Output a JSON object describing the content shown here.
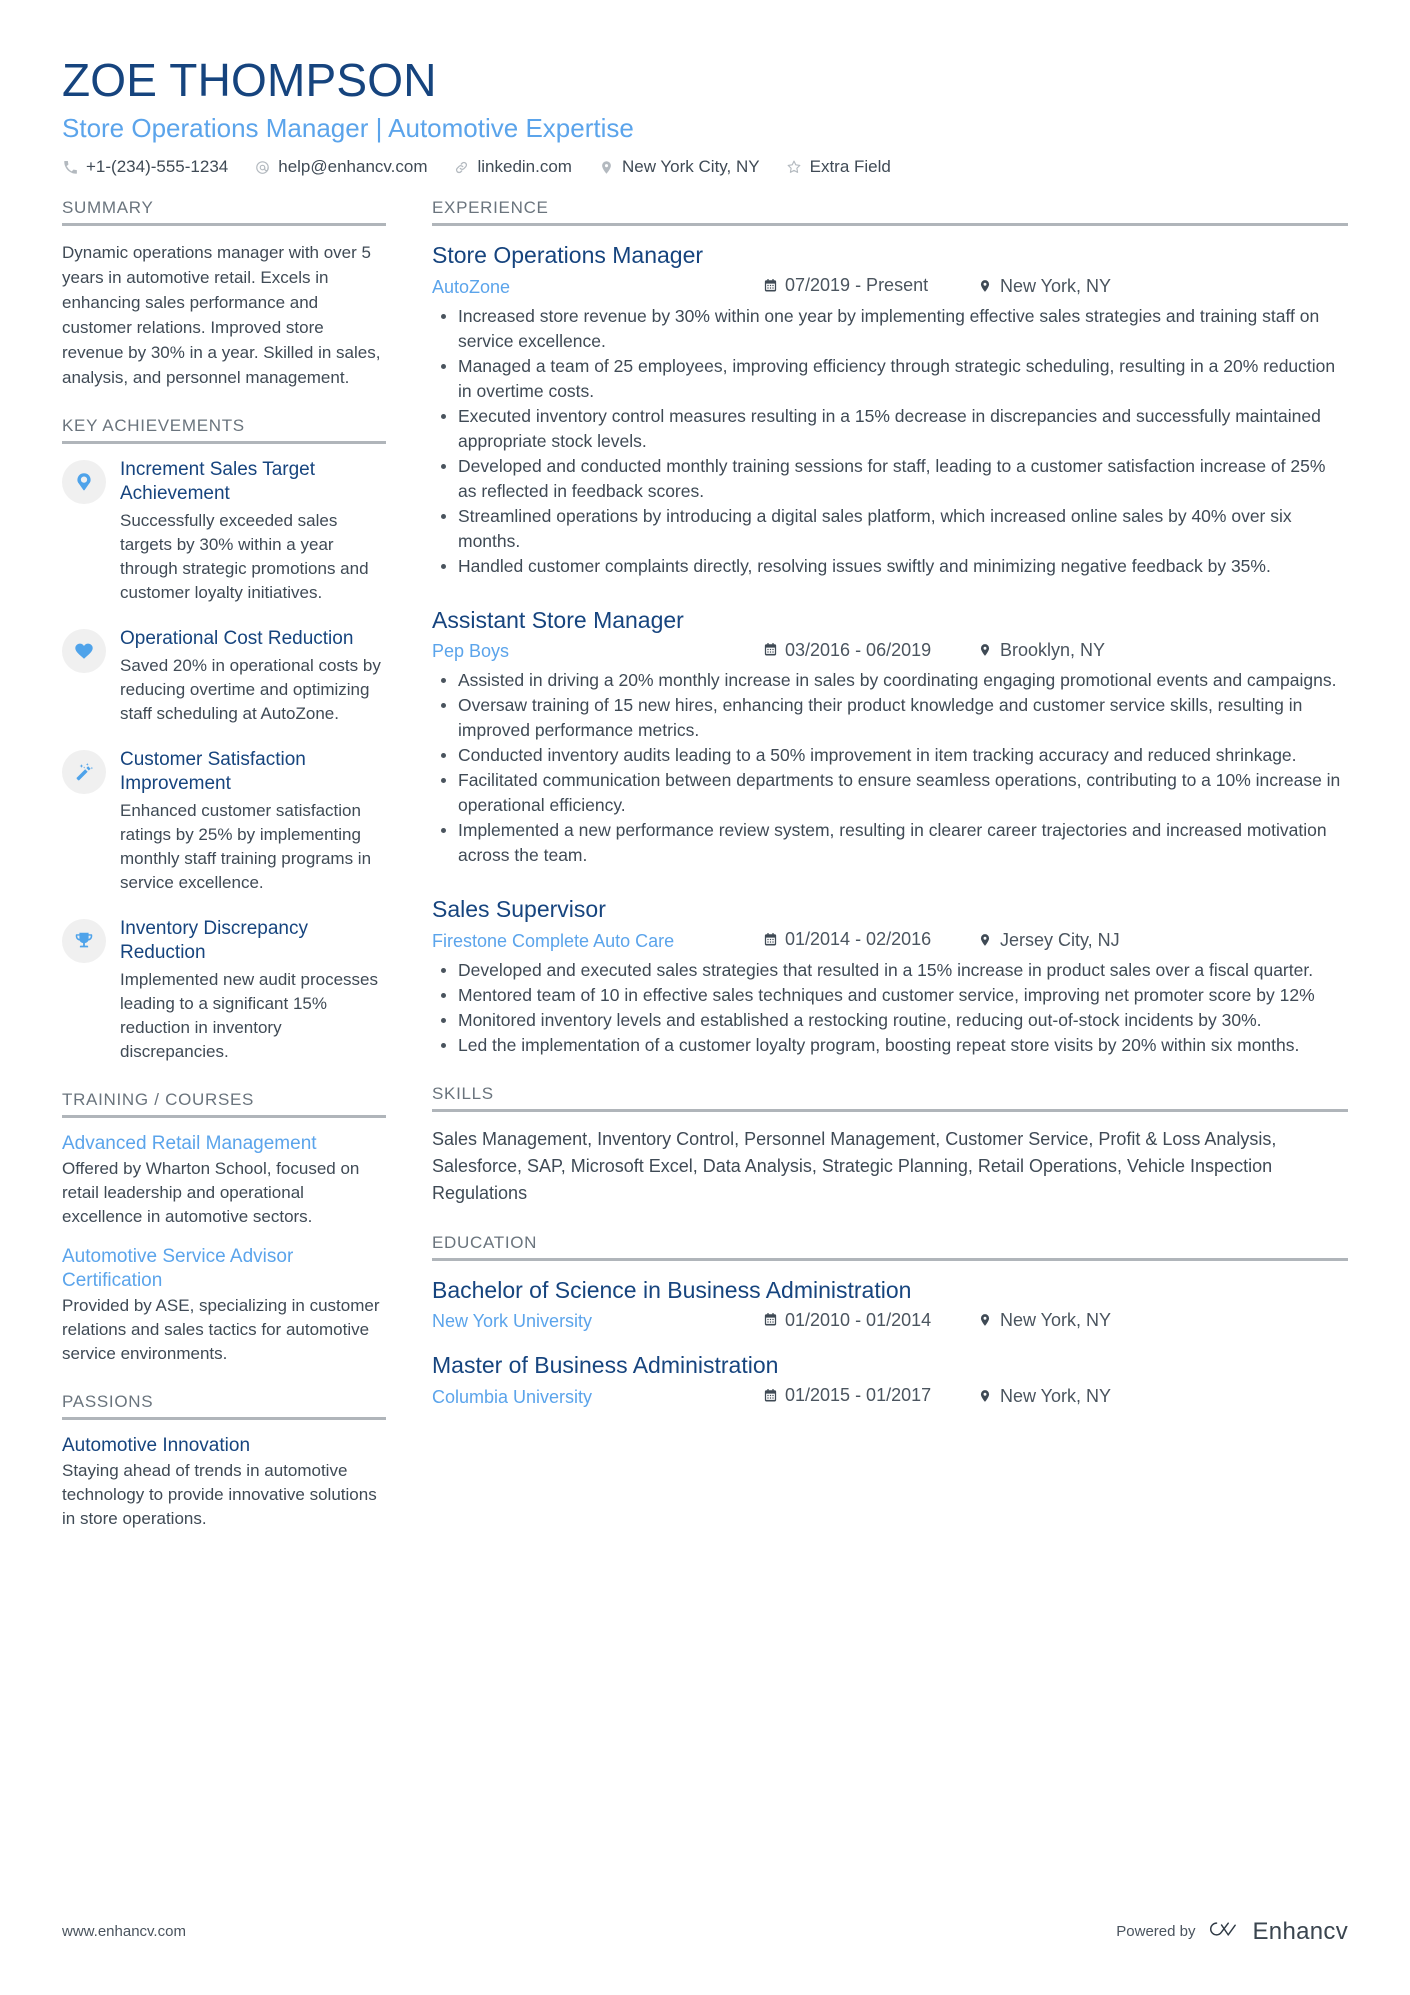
{
  "header": {
    "full_name": "ZOE THOMPSON",
    "job_title": "Store Operations Manager | Automotive Expertise",
    "contacts": [
      {
        "icon": "phone-icon",
        "text": "+1-(234)-555-1234"
      },
      {
        "icon": "email-icon",
        "text": "help@enhancv.com"
      },
      {
        "icon": "link-icon",
        "text": "linkedin.com"
      },
      {
        "icon": "location-pin-icon",
        "text": "New York City, NY"
      },
      {
        "icon": "star-icon",
        "text": "Extra Field"
      }
    ]
  },
  "left": {
    "summary": {
      "section_title": "SUMMARY",
      "text": "Dynamic operations manager with over 5 years in automotive retail. Excels in enhancing sales performance and customer relations. Improved store revenue by 30% in a year. Skilled in sales, analysis, and personnel management."
    },
    "key_achievements": {
      "section_title": "KEY ACHIEVEMENTS",
      "items": [
        {
          "icon": "tag-pin-icon",
          "title": "Increment Sales Target Achievement",
          "description": "Successfully exceeded sales targets by 30% within a year through strategic promotions and customer loyalty initiatives."
        },
        {
          "icon": "heart-icon",
          "title": "Operational Cost Reduction",
          "description": "Saved 20% in operational costs by reducing overtime and optimizing staff scheduling at AutoZone."
        },
        {
          "icon": "magic-wand-icon",
          "title": "Customer Satisfaction Improvement",
          "description": "Enhanced customer satisfaction ratings by 25% by implementing monthly staff training programs in service excellence."
        },
        {
          "icon": "trophy-icon",
          "title": "Inventory Discrepancy Reduction",
          "description": "Implemented new audit processes leading to a significant 15% reduction in inventory discrepancies."
        }
      ]
    },
    "training": {
      "section_title": "TRAINING / COURSES",
      "items": [
        {
          "title": "Advanced Retail Management",
          "description": "Offered by Wharton School, focused on retail leadership and operational excellence in automotive sectors."
        },
        {
          "title": "Automotive Service Advisor Certification",
          "description": "Provided by ASE, specializing in customer relations and sales tactics for automotive service environments."
        }
      ]
    },
    "passions": {
      "section_title": "PASSIONS",
      "items": [
        {
          "title": "Automotive Innovation",
          "description": "Staying ahead of trends in automotive technology to provide innovative solutions in store operations."
        }
      ]
    }
  },
  "right": {
    "experience": {
      "section_title": "EXPERIENCE",
      "entries": [
        {
          "title": "Store Operations Manager",
          "organization": "AutoZone",
          "dates": "07/2019 - Present",
          "location": "New York, NY",
          "bullets": [
            "Increased store revenue by 30% within one year by implementing effective sales strategies and training staff on service excellence.",
            "Managed a team of 25 employees, improving efficiency through strategic scheduling, resulting in a 20% reduction in overtime costs.",
            "Executed inventory control measures resulting in a 15% decrease in discrepancies and successfully maintained appropriate stock levels.",
            "Developed and conducted monthly training sessions for staff, leading to a customer satisfaction increase of 25% as reflected in feedback scores.",
            "Streamlined operations by introducing a digital sales platform, which increased online sales by 40% over six months.",
            "Handled customer complaints directly, resolving issues swiftly and minimizing negative feedback by 35%."
          ]
        },
        {
          "title": "Assistant Store Manager",
          "organization": "Pep Boys",
          "dates": "03/2016 - 06/2019",
          "location": "Brooklyn, NY",
          "bullets": [
            "Assisted in driving a 20% monthly increase in sales by coordinating engaging promotional events and campaigns.",
            "Oversaw training of 15 new hires, enhancing their product knowledge and customer service skills, resulting in improved performance metrics.",
            "Conducted inventory audits leading to a 50% improvement in item tracking accuracy and reduced shrinkage.",
            "Facilitated communication between departments to ensure seamless operations, contributing to a 10% increase in operational efficiency.",
            "Implemented a new performance review system, resulting in clearer career trajectories and increased motivation across the team."
          ]
        },
        {
          "title": "Sales Supervisor",
          "organization": "Firestone Complete Auto Care",
          "dates": "01/2014 - 02/2016",
          "location": "Jersey City, NJ",
          "bullets": [
            "Developed and executed sales strategies that resulted in a 15% increase in product sales over a fiscal quarter.",
            "Mentored team of 10 in effective sales techniques and customer service, improving net promoter score by 12%",
            "Monitored inventory levels and established a restocking routine, reducing out-of-stock incidents by 30%.",
            "Led the implementation of a customer loyalty program, boosting repeat store visits by 20% within six months."
          ]
        }
      ]
    },
    "skills": {
      "section_title": "SKILLS",
      "text": "Sales Management, Inventory Control, Personnel Management, Customer Service, Profit & Loss Analysis, Salesforce, SAP, Microsoft Excel, Data Analysis, Strategic Planning, Retail Operations, Vehicle Inspection Regulations"
    },
    "education": {
      "section_title": "EDUCATION",
      "entries": [
        {
          "title": "Bachelor of Science in Business Administration",
          "organization": "New York University",
          "dates": "01/2010 - 01/2014",
          "location": "New York, NY"
        },
        {
          "title": "Master of Business Administration",
          "organization": "Columbia University",
          "dates": "01/2015 - 01/2017",
          "location": "New York, NY"
        }
      ]
    }
  },
  "footer": {
    "url": "www.enhancv.com",
    "powered_by": "Powered by",
    "brand_name": "Enhancv"
  },
  "colors": {
    "navy": "#16447e",
    "light_blue": "#5ba4eb",
    "icon_blue": "#4fa3ea",
    "body_text": "#3f4a55",
    "rule": "#b0b5ba",
    "badge_bg": "#f0f0f0"
  }
}
